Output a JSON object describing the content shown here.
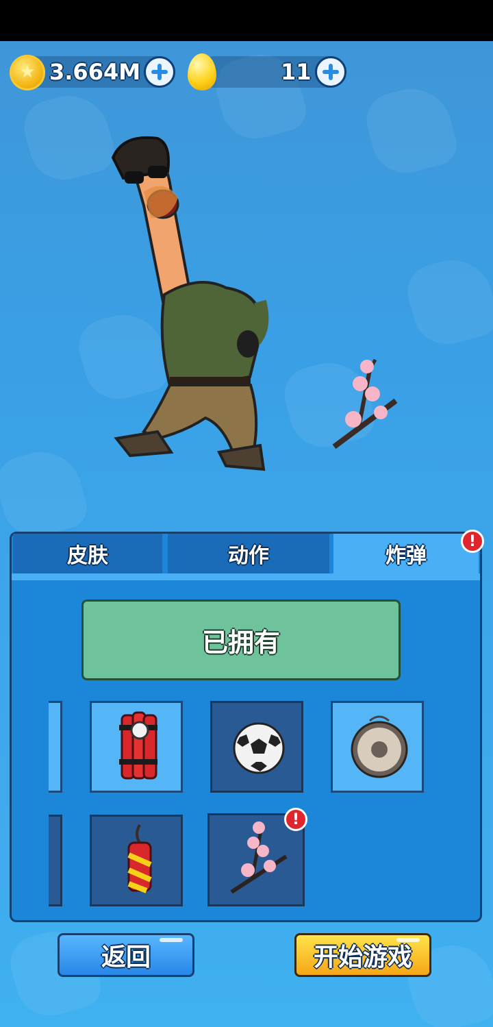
{
  "currency": {
    "coins": "3.664M",
    "eggs": "11"
  },
  "tabs": [
    {
      "label": "皮肤",
      "active": false
    },
    {
      "label": "动作",
      "active": false
    },
    {
      "label": "炸弹",
      "active": true
    }
  ],
  "badge_symbol": "!",
  "owned_label": "已拥有",
  "items": [
    {
      "name": "dynamite",
      "selected": false
    },
    {
      "name": "soccer-ball",
      "selected": true
    },
    {
      "name": "gong",
      "selected": false
    },
    {
      "name": "firecracker",
      "selected": false
    },
    {
      "name": "cherry-blossom-branch",
      "selected": false,
      "new": true
    }
  ],
  "buttons": {
    "back": "返回",
    "start": "开始游戏"
  },
  "colors": {
    "owned_green": "#6ec39d",
    "start_yellow": "#f5a616",
    "badge_red": "#e0252d",
    "tab_active": "#4ab0f6"
  }
}
